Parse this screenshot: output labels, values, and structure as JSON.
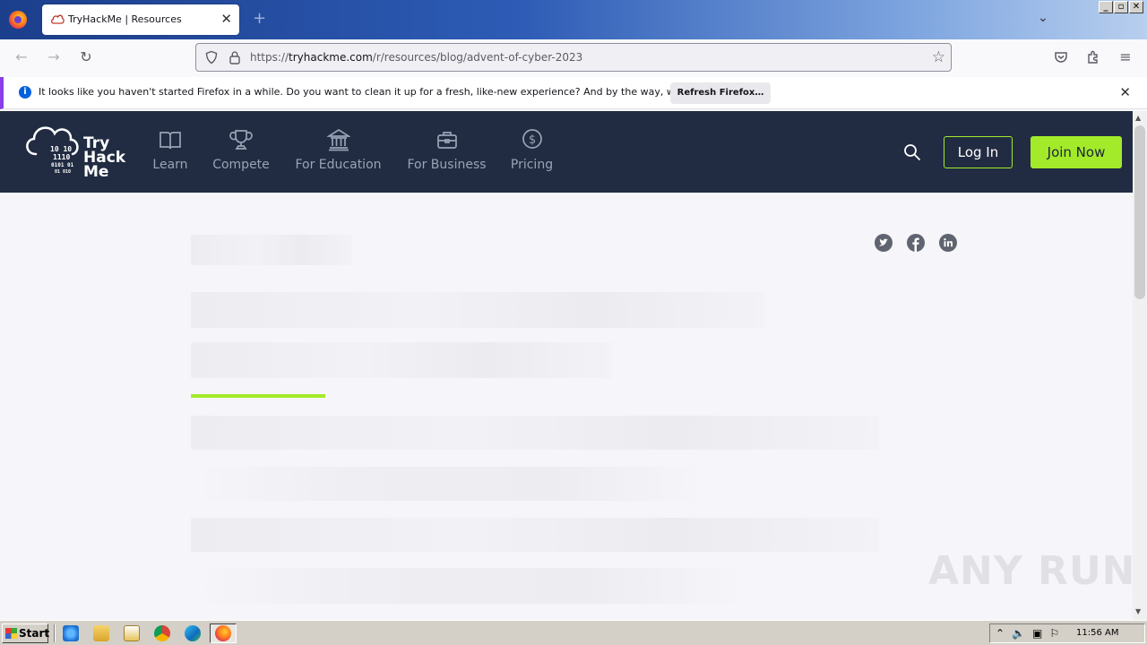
{
  "browser": {
    "tab": {
      "title": "TryHackMe | Resources"
    },
    "url": {
      "prefix": "https://",
      "host": "tryhackme.com",
      "path": "/r/resources/blog/advent-of-cyber-2023"
    },
    "notification": {
      "message": "It looks like you haven't started Firefox in a while. Do you want to clean it up for a fresh, like-new experience? And by the way, welcome back!",
      "button_label": "Refresh Firefox…"
    }
  },
  "site": {
    "logo": {
      "line1": "Try",
      "line2": "Hack",
      "line3": "Me"
    },
    "menu": [
      {
        "label": "Learn",
        "icon": "book-icon"
      },
      {
        "label": "Compete",
        "icon": "trophy-icon"
      },
      {
        "label": "For Education",
        "icon": "institution-icon"
      },
      {
        "label": "For Business",
        "icon": "briefcase-icon"
      },
      {
        "label": "Pricing",
        "icon": "dollar-icon"
      }
    ],
    "login_label": "Log In",
    "join_label": "Join Now",
    "accent_color": "#a3ea2a",
    "nav_bg": "#212c42"
  },
  "watermark": "ANY RUN",
  "taskbar": {
    "start_label": "Start",
    "clock": "11:56 AM"
  }
}
